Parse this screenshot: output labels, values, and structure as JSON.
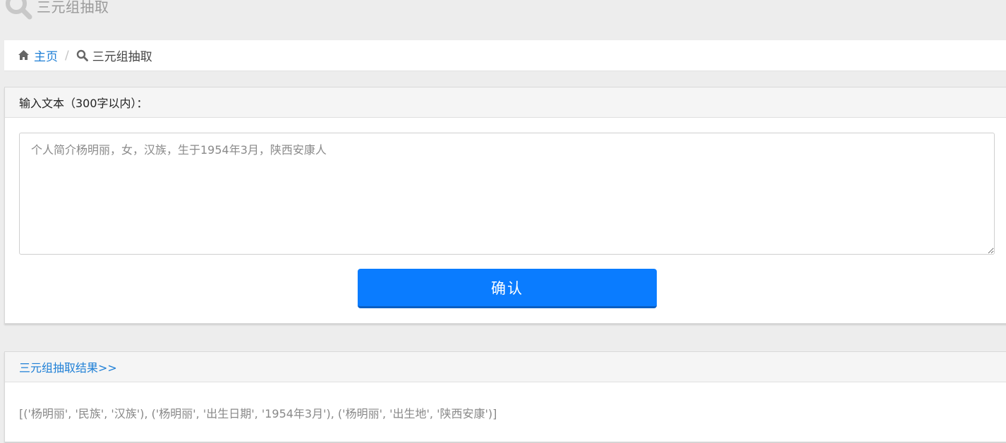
{
  "page": {
    "title": "三元组抽取"
  },
  "breadcrumb": {
    "home": "主页",
    "separator": "/",
    "current": "三元组抽取"
  },
  "input_panel": {
    "heading": "输入文本（300字以内）：",
    "textarea_placeholder": "个人简介杨明丽，女，汉族，生于1954年3月，陕西安康人",
    "confirm_label": "确认"
  },
  "result_panel": {
    "heading": "三元组抽取结果>>",
    "result": "[('杨明丽', '民族', '汉族'), ('杨明丽', '出生日期', '1954年3月'), ('杨明丽', '出生地', '陕西安康')]"
  },
  "colors": {
    "accent": "#0a7cff",
    "link": "#1e7fd6",
    "background": "#ededed"
  },
  "icons": {
    "header": "search-icon",
    "breadcrumb_home": "home-icon",
    "breadcrumb_current": "search-icon"
  }
}
